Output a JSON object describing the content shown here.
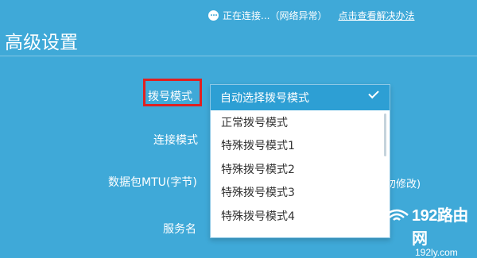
{
  "status": {
    "text": "正在连接...（网络异常）",
    "link": "点击查看解决办法"
  },
  "page": {
    "title": "高级设置"
  },
  "form": {
    "dial_label": "拨号模式",
    "connect_label": "连接模式",
    "mtu_label": "数据包MTU(字节)",
    "service_label": "服务名",
    "mtu_hint": "勿修改)"
  },
  "dropdown": {
    "selected": "自动选择拨号模式",
    "options": [
      "正常拨号模式",
      "特殊拨号模式1",
      "特殊拨号模式2",
      "特殊拨号模式3",
      "特殊拨号模式4"
    ]
  },
  "watermark": {
    "logo": "192路由网",
    "url": "192ly.com"
  },
  "colors": {
    "background": "#3fa9d8",
    "selected": "#2d9fd4",
    "highlight_box": "#e02020"
  }
}
